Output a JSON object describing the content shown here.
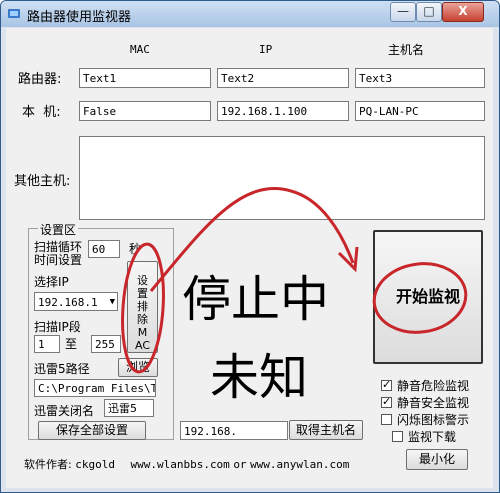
{
  "window": {
    "title": "路由器使用监视器",
    "minimize_glyph": "—",
    "maximize_glyph": "□",
    "close_glyph": "X"
  },
  "headers": {
    "mac": "MAC",
    "ip": "IP",
    "hostname": "主机名"
  },
  "router": {
    "label": "路由器:",
    "mac": "Text1",
    "ip": "Text2",
    "hostname": "Text3"
  },
  "local": {
    "label": "本  机:",
    "mac": "False",
    "ip": "192.168.1.100",
    "hostname": "PQ-LAN-PC"
  },
  "others": {
    "label": "其他主机:"
  },
  "settings": {
    "legend": "设置区",
    "scan_cycle_label_1": "扫描循环",
    "scan_cycle_label_2": "时间设置",
    "scan_cycle_value": "60",
    "scan_cycle_unit": "秒",
    "select_ip_label": "选择IP",
    "select_ip_value": "192.168.1",
    "scan_range_label": "扫描IP段",
    "range_start": "1",
    "range_to": "至",
    "range_end": "255",
    "set_exclude_button": "设置排除MAC",
    "xunlei_path_label": "迅雷5路径",
    "browse_button": "浏览",
    "xunlei_path_value": "C:\\Program Files\\T",
    "xunlei_close_label": "迅雷关闭名",
    "xunlei_close_value": "迅雷5",
    "save_all_button": "保存全部设置"
  },
  "status": {
    "line1": "停止中",
    "line2": "未知"
  },
  "start_button": "开始监视",
  "ip_display": "192.168.",
  "get_hostname_button": "取得主机名",
  "options": [
    {
      "label": "静音危险监视",
      "checked": true
    },
    {
      "label": "静音安全监视",
      "checked": true
    },
    {
      "label": "闪烁图标警示",
      "checked": false
    },
    {
      "label": "监视下载",
      "checked": false
    }
  ],
  "minimize_button": "最小化",
  "footer": {
    "author_label": "软件作者:",
    "author": "ckgold",
    "url1": "www.wlanbbs.com",
    "or": "or",
    "url2": "www.anywlan.com"
  },
  "colors": {
    "annotation": "#c8262a",
    "title_gradient_top": "#cfe0f3",
    "title_gradient_bottom": "#a9c4e4"
  }
}
